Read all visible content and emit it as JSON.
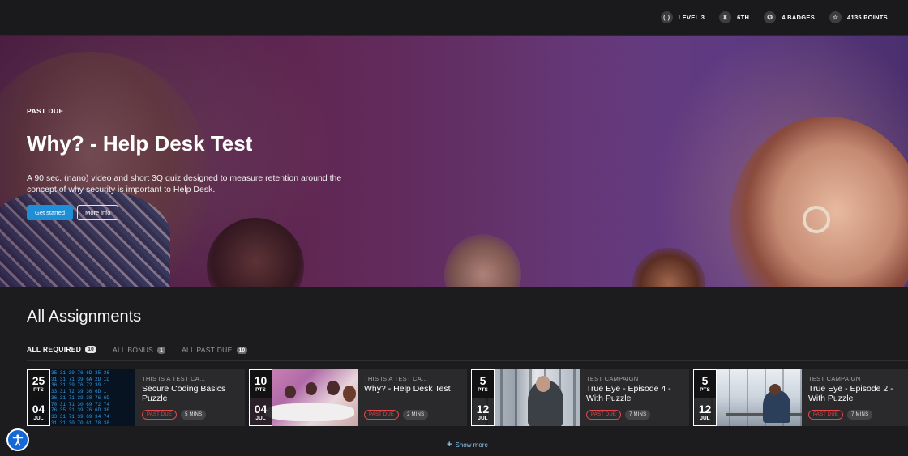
{
  "header": {
    "stats": [
      {
        "icon": "level-icon",
        "glyph": "( )",
        "label": "LEVEL 3"
      },
      {
        "icon": "rank-icon",
        "glyph": "♜",
        "label": "6TH"
      },
      {
        "icon": "badge-icon",
        "glyph": "✪",
        "label": "4 BADGES"
      },
      {
        "icon": "star-icon",
        "glyph": "☆",
        "label": "4135 POINTS"
      }
    ]
  },
  "hero": {
    "tag": "PAST DUE",
    "title": "Why? - Help Desk Test",
    "description": "A 90 sec. (nano) video and short 3Q quiz designed to measure retention around the concept of why security is important to Help Desk.",
    "primary_button": "Get started",
    "secondary_button": "More info"
  },
  "assignments": {
    "title": "All Assignments",
    "tabs": [
      {
        "label": "ALL REQUIRED",
        "count": "10",
        "active": true
      },
      {
        "label": "ALL BONUS",
        "count": "1",
        "active": false
      },
      {
        "label": "ALL PAST DUE",
        "count": "10",
        "active": false
      }
    ],
    "cards": [
      {
        "points": "25",
        "pts_label": "PTS",
        "day": "04",
        "month": "JUL",
        "campaign": "THIS IS A TEST CA...",
        "title": "Secure Coding Basics Puzzle",
        "status": "PAST DUE",
        "duration": "5 MINS"
      },
      {
        "points": "10",
        "pts_label": "PTS",
        "day": "04",
        "month": "JUL",
        "campaign": "THIS IS A TEST CA...",
        "title": "Why? - Help Desk Test",
        "status": "PAST DUE",
        "duration": "2 MINS"
      },
      {
        "points": "5",
        "pts_label": "PTS",
        "day": "12",
        "month": "JUL",
        "campaign": "TEST CAMPAIGN",
        "title": "True Eye - Episode 4 - With Puzzle",
        "status": "PAST DUE",
        "duration": "7 MINS"
      },
      {
        "points": "5",
        "pts_label": "PTS",
        "day": "12",
        "month": "JUL",
        "campaign": "TEST CAMPAIGN",
        "title": "True Eye - Episode 2 - With Puzzle",
        "status": "PAST DUE",
        "duration": "7 MINS"
      }
    ],
    "show_more": "Show more"
  },
  "code_thumb_text": "35 31 39 76 6D 35 36\n31 31 71 39 6A 2D 1D\n36 31 39 76 72 39 1\n33 31 72 39 36 6D 1\n36 31 71 39 38 76 6D\n70 31 71 30 69 72 74\n76 35 31 39 76 6D 36\n33 31 71 39 69 34 74\n31 31 30 70 61 78 38\n36 31 75 39 76 30 31\n6D 39 73 31 39 76 31\n31 33 31 35 71 30 33",
  "colors": {
    "accent": "#1e8fd6",
    "past_due": "#e0474c",
    "link": "#8fc6ee"
  }
}
